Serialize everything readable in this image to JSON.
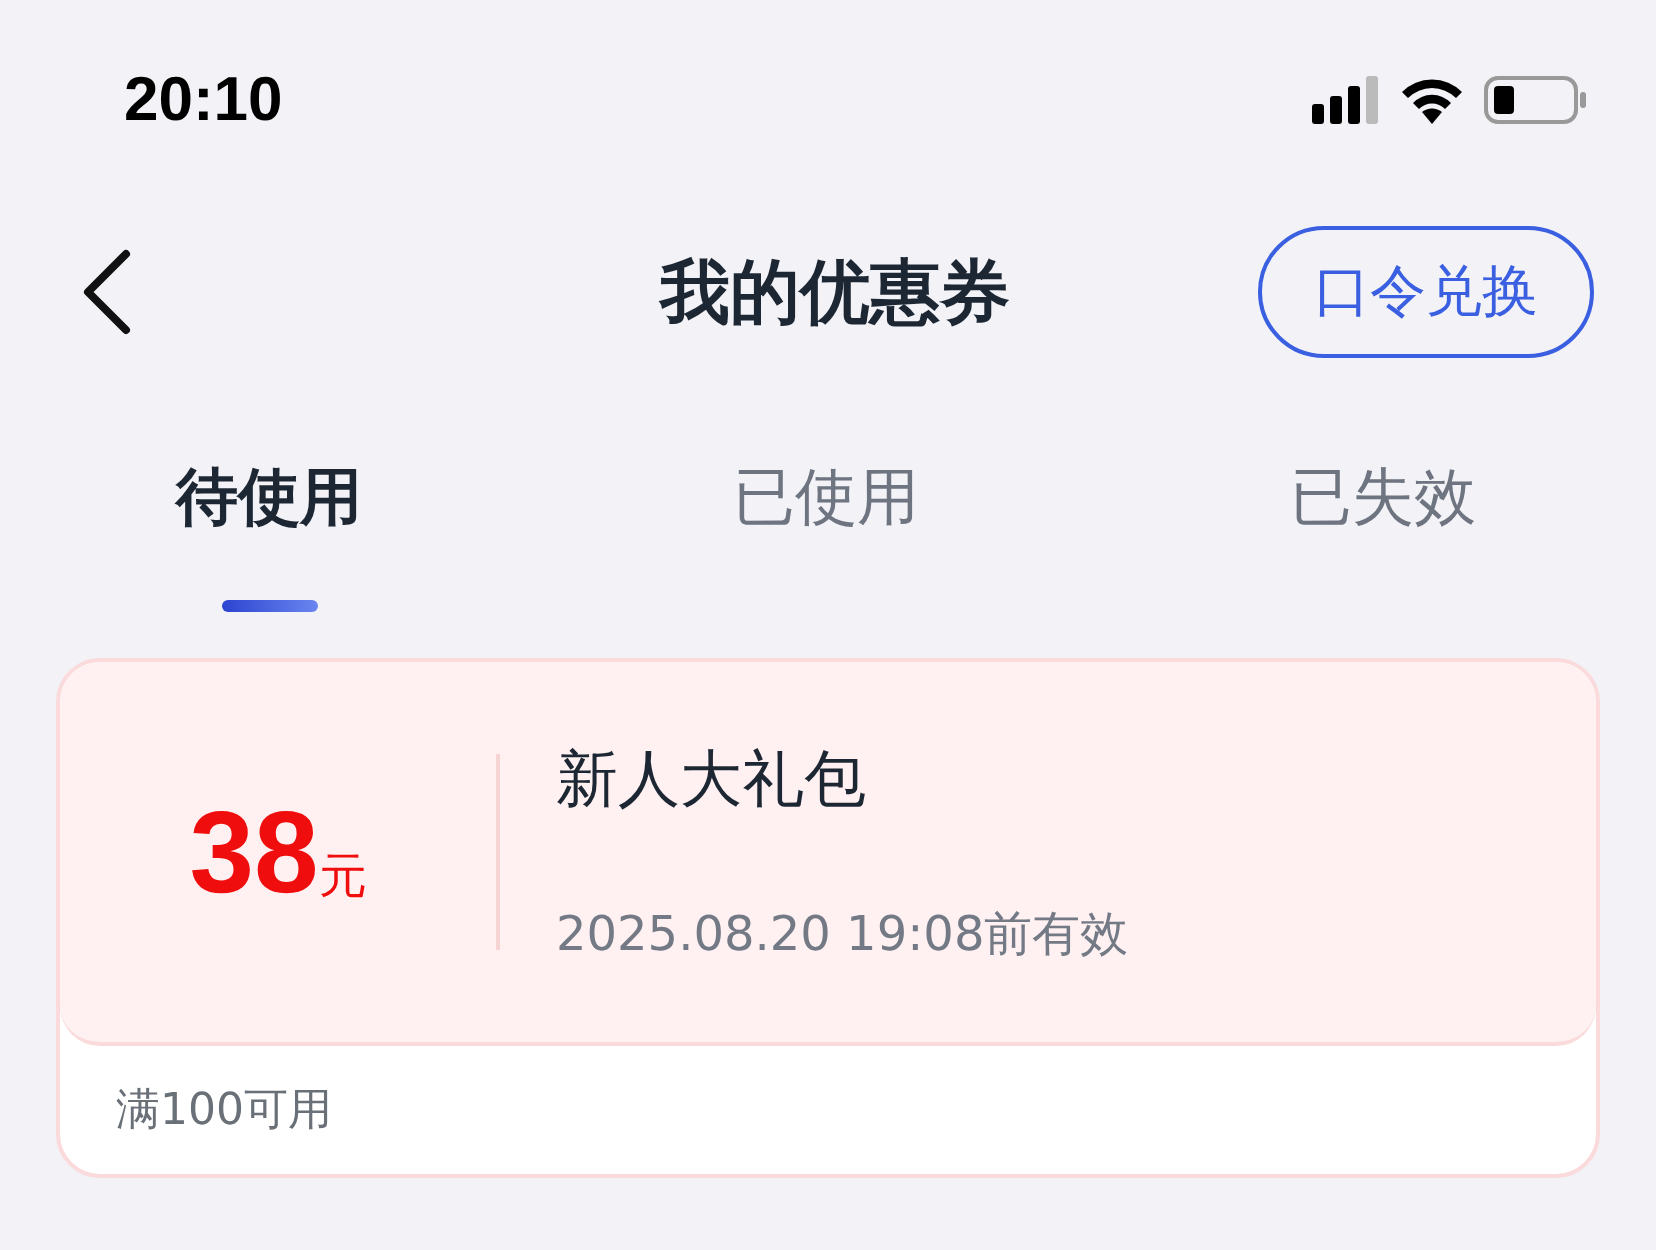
{
  "status_bar": {
    "time": "20:10"
  },
  "nav": {
    "title": "我的优惠券",
    "action": "口令兑换"
  },
  "tabs": [
    {
      "label": "待使用",
      "selected": true
    },
    {
      "label": "已使用",
      "selected": false
    },
    {
      "label": "已失效",
      "selected": false
    }
  ],
  "coupons": [
    {
      "amount": "38",
      "unit": "元",
      "name": "新人大礼包",
      "expiry": "2025.08.20 19:08前有效",
      "condition": "满100可用"
    }
  ]
}
